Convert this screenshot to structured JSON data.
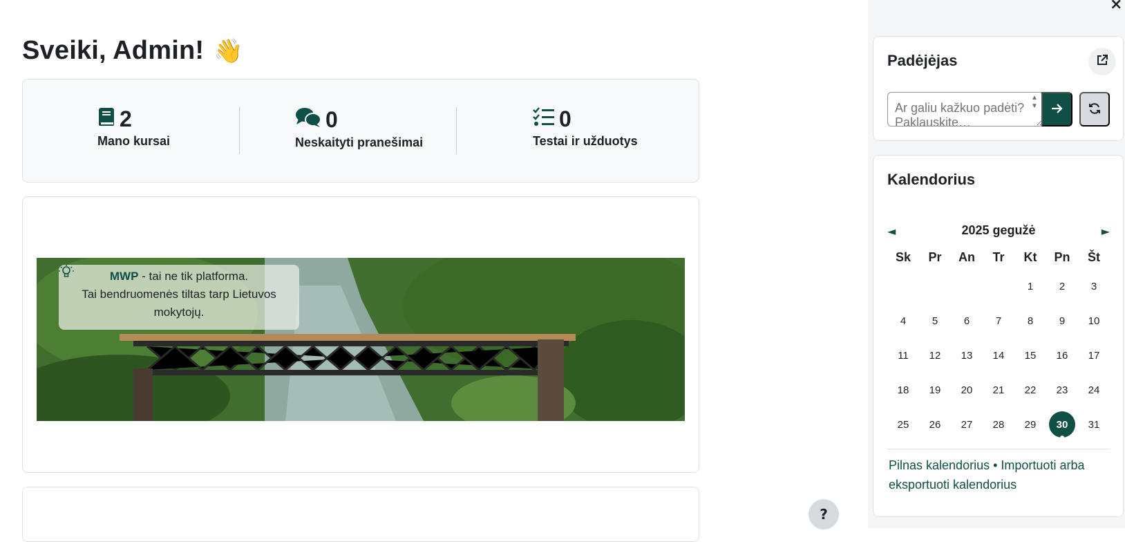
{
  "greeting": {
    "title": "Sveiki, Admin!",
    "emoji": "👋"
  },
  "stats": [
    {
      "icon": "book-icon",
      "value": "2",
      "label": "Mano kursai"
    },
    {
      "icon": "chat-bubbles-icon",
      "value": "0",
      "label": "Neskaityti pranešimai"
    },
    {
      "icon": "checklist-icon",
      "value": "0",
      "label": "Testai ir užduotys"
    }
  ],
  "banner": {
    "brand": "MWP",
    "line1_rest": " - tai ne tik platforma.",
    "line2": "Tai bendruomenės tiltas tarp Lietuvos",
    "line3": "mokytojų."
  },
  "help_button": "?",
  "drawer": {
    "close_label": "×"
  },
  "assistant": {
    "title": "Padėjėjas",
    "placeholder": "Ar galiu kažkuo padėti? Paklauskite…"
  },
  "calendar": {
    "title": "Kalendorius",
    "month_label": "2025 gegužė",
    "prev_label": "◄",
    "next_label": "►",
    "weekdays": [
      "Sk",
      "Pr",
      "An",
      "Tr",
      "Kt",
      "Pn",
      "Št"
    ],
    "weeks": [
      [
        "",
        "",
        "",
        "",
        "1",
        "2",
        "3"
      ],
      [
        "4",
        "5",
        "6",
        "7",
        "8",
        "9",
        "10"
      ],
      [
        "11",
        "12",
        "13",
        "14",
        "15",
        "16",
        "17"
      ],
      [
        "18",
        "19",
        "20",
        "21",
        "22",
        "23",
        "24"
      ],
      [
        "25",
        "26",
        "27",
        "28",
        "29",
        "30",
        "31"
      ]
    ],
    "today": "30",
    "link_full": "Pilnas kalendorius",
    "link_separator": " • ",
    "link_export": "Importuoti arba eksportuoti kalendorius"
  },
  "colors": {
    "accent": "#0f4f46",
    "card_bg": "#f8f9fa",
    "border": "#dee2e6"
  }
}
